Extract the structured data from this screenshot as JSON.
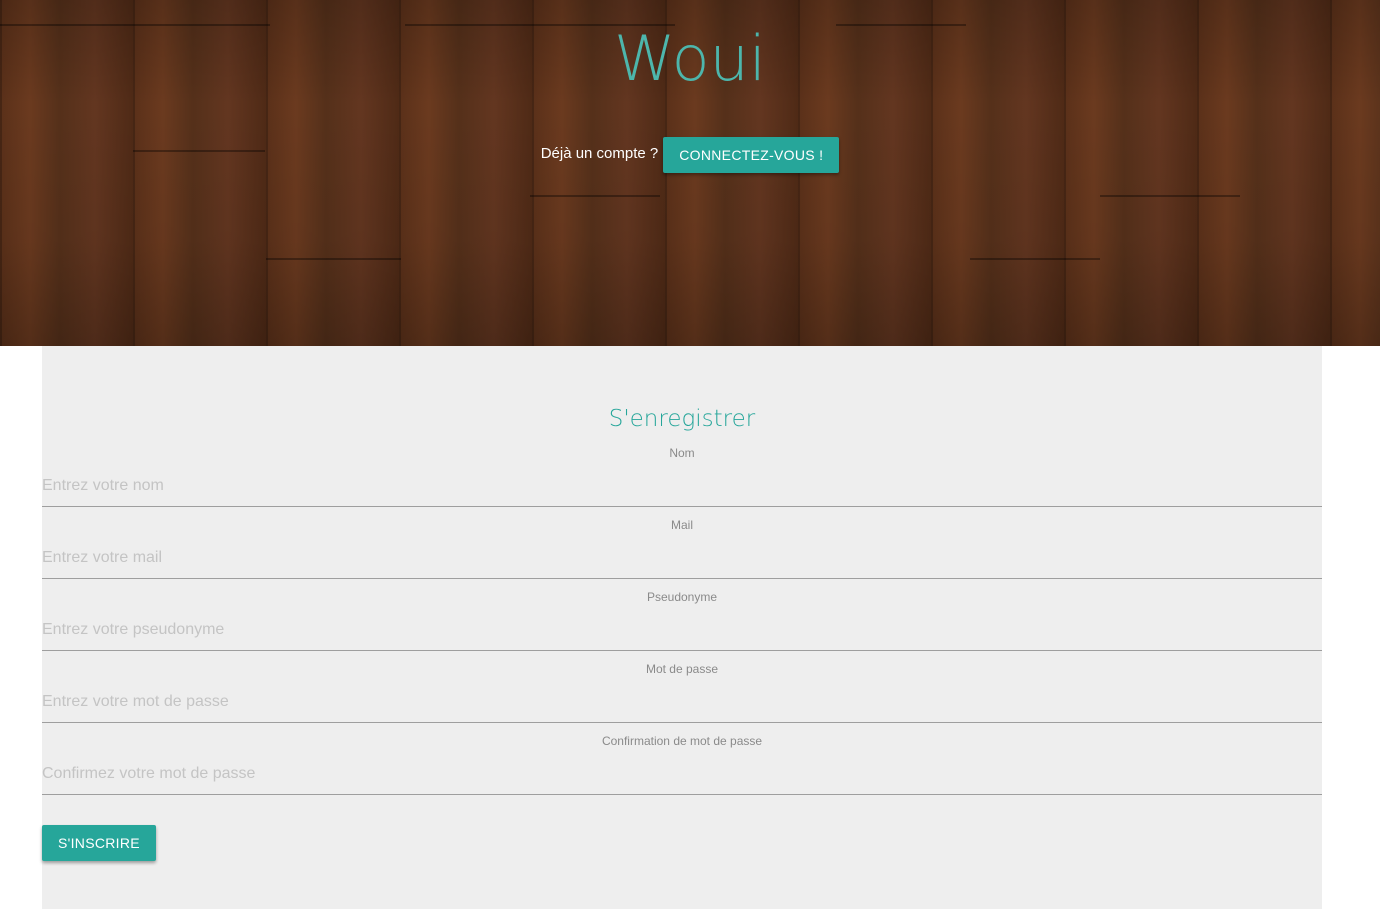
{
  "header": {
    "title": "Woui",
    "login_prompt": "Déjà un compte ?",
    "login_button": "Connectez-vous !"
  },
  "register": {
    "title": "S'enregistrer",
    "fields": [
      {
        "label": "Nom",
        "placeholder": "Entrez votre nom"
      },
      {
        "label": "Mail",
        "placeholder": "Entrez votre mail"
      },
      {
        "label": "Pseudonyme",
        "placeholder": "Entrez votre pseudonyme"
      },
      {
        "label": "Mot de passe",
        "placeholder": "Entrez votre mot de passe"
      },
      {
        "label": "Confirmation de mot de passe",
        "placeholder": "Confirmez votre mot de passe"
      }
    ],
    "submit_button": "S'inscrire"
  },
  "colors": {
    "accent": "#26a69a",
    "title_accent": "#4db6ac",
    "card_background": "#eeeeee",
    "hero_wood": "#5a3019"
  }
}
